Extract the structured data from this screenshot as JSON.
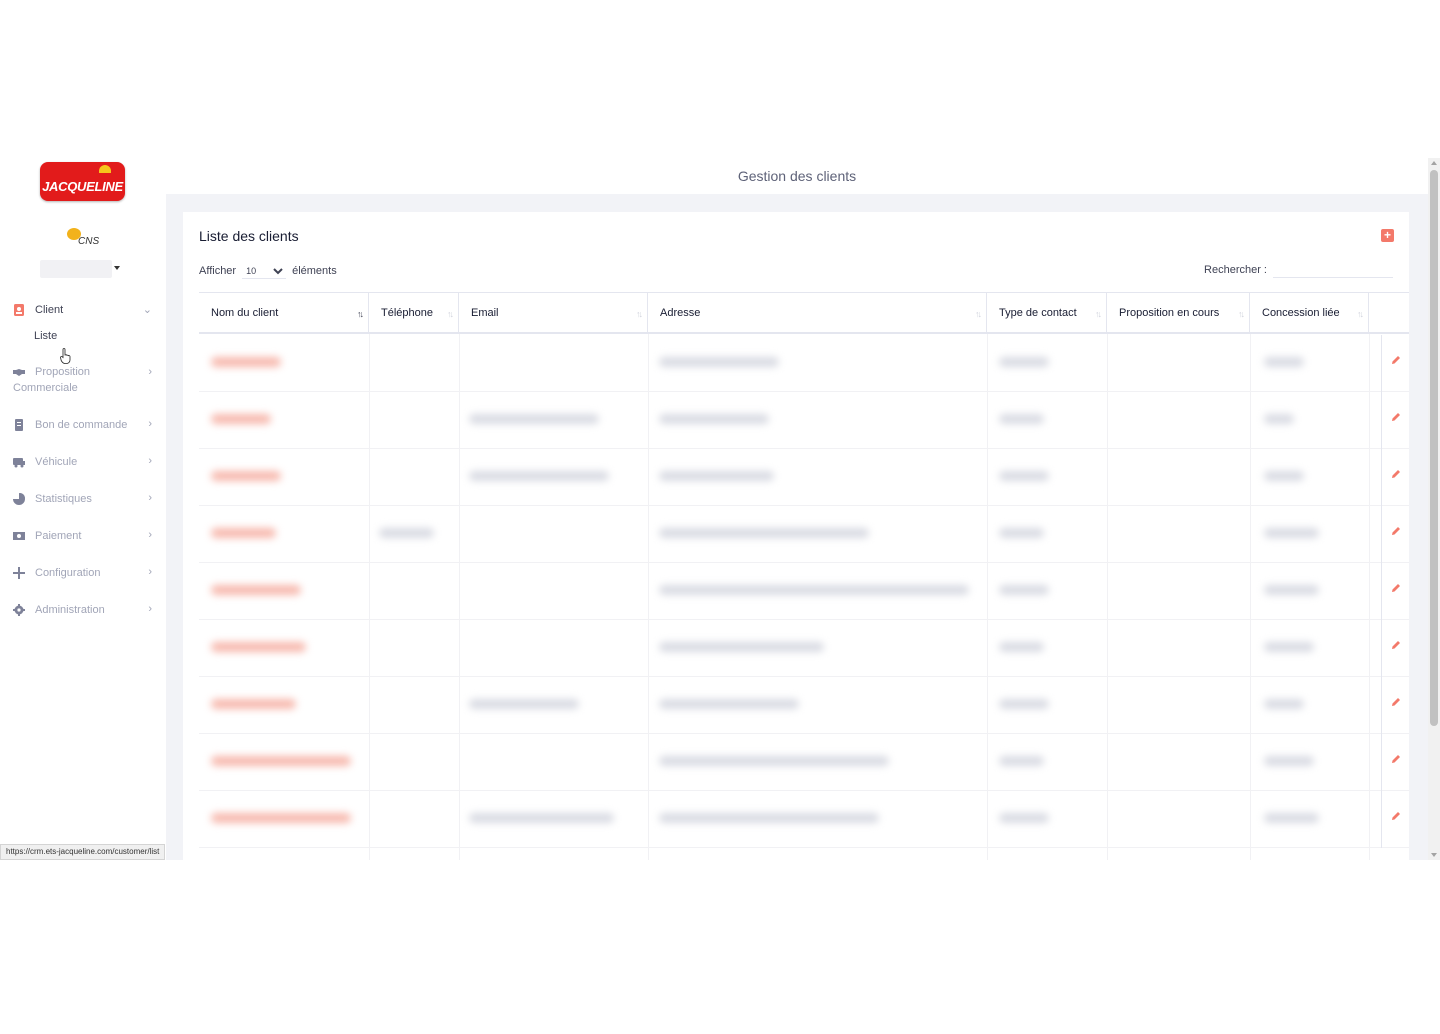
{
  "brand": {
    "logo_text": "JACQUELINE",
    "company_text": "CNS"
  },
  "page": {
    "header_title": "Gestion des clients"
  },
  "sidebar": {
    "items": [
      {
        "label": "Client",
        "icon": "address-card-icon",
        "expanded": true,
        "sub": [
          {
            "label": "Liste"
          }
        ]
      },
      {
        "label": "Proposition",
        "label2": "Commerciale",
        "icon": "handshake-icon"
      },
      {
        "label": "Bon de commande",
        "icon": "document-icon"
      },
      {
        "label": "Véhicule",
        "icon": "camper-van-icon"
      },
      {
        "label": "Statistiques",
        "icon": "pie-chart-icon"
      },
      {
        "label": "Paiement",
        "icon": "money-bill-icon"
      },
      {
        "label": "Configuration",
        "icon": "plus-icon"
      },
      {
        "label": "Administration",
        "icon": "gear-icon"
      }
    ]
  },
  "card": {
    "title": "Liste des clients",
    "length": {
      "label_before": "Afficher",
      "value": "10",
      "label_after": "éléments"
    },
    "search": {
      "label": "Rechercher :"
    }
  },
  "table": {
    "columns": [
      "Nom du client",
      "Téléphone",
      "Email",
      "Adresse",
      "Type de contact",
      "Proposition en cours",
      "Concession liée"
    ],
    "sorted_column": 0
  },
  "status_bar": {
    "url": "https://crm.ets-jacqueline.com/customer/list"
  },
  "colors": {
    "accent": "#f3796a",
    "brand_red": "#e21b1b",
    "sidebar_text": "#a1a5b7"
  }
}
